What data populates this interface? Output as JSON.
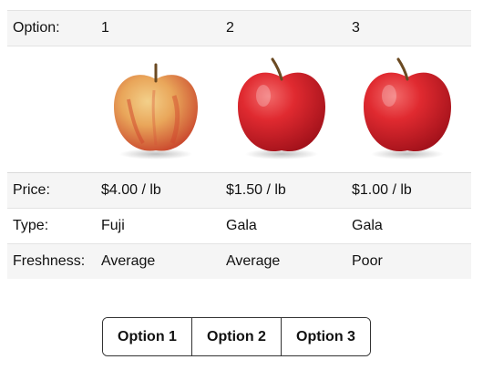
{
  "table": {
    "header": {
      "label": "Option:",
      "options": [
        "1",
        "2",
        "3"
      ]
    },
    "images": [
      {
        "icon": "fuji-apple-image"
      },
      {
        "icon": "gala-apple-image"
      },
      {
        "icon": "gala-apple-image"
      }
    ],
    "price": {
      "label": "Price:",
      "values": [
        "$4.00 / lb",
        "$1.50 / lb",
        "$1.00 / lb"
      ]
    },
    "type": {
      "label": "Type:",
      "values": [
        "Fuji",
        "Gala",
        "Gala"
      ]
    },
    "freshness": {
      "label": "Freshness:",
      "values": [
        "Average",
        "Average",
        "Poor"
      ]
    }
  },
  "choices": {
    "buttons": [
      "Option 1",
      "Option 2",
      "Option 3"
    ]
  },
  "colors": {
    "fuji_base": "#e8b15a",
    "fuji_red": "#d94a2e",
    "gala_red": "#d8202c",
    "stem": "#6b4a22"
  }
}
